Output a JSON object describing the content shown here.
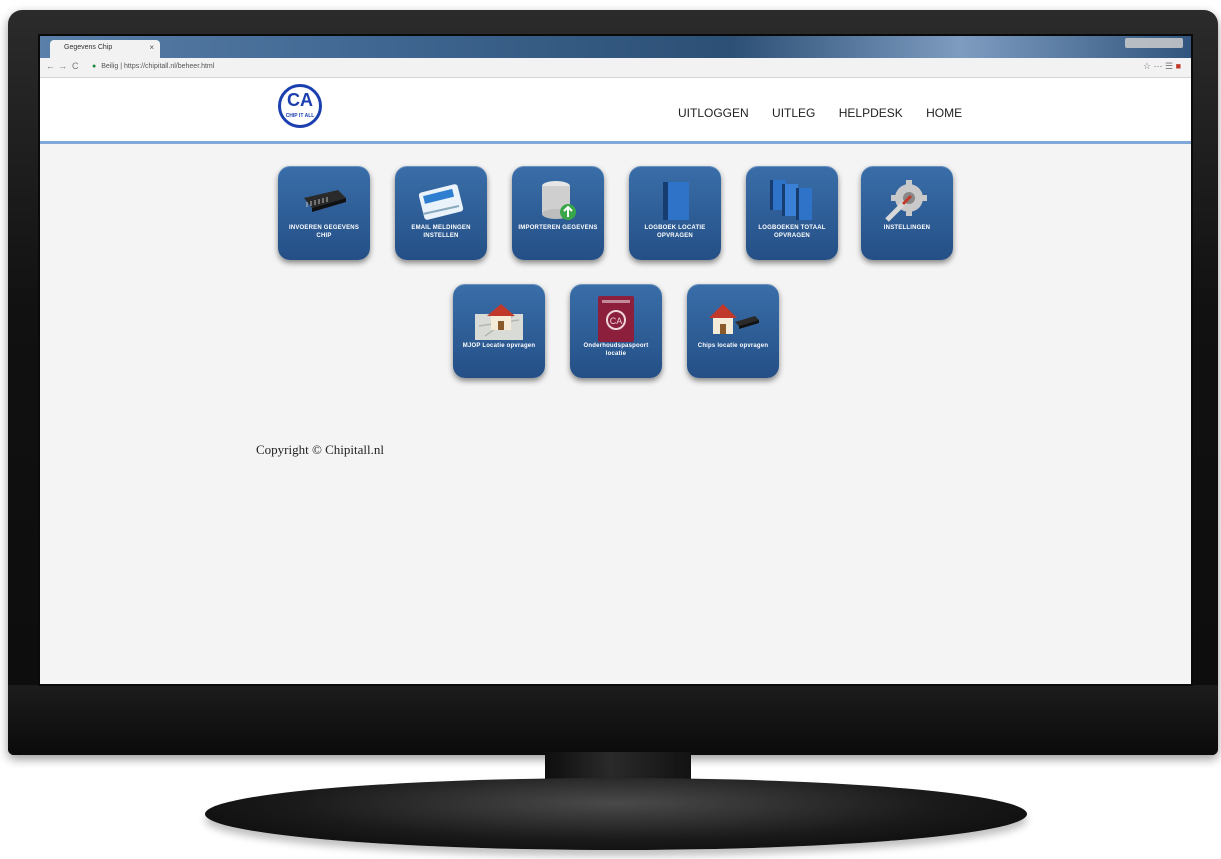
{
  "browser": {
    "tab_title": "Gegevens Chip",
    "tab_close": "×",
    "back_glyph": "←",
    "forward_glyph": "→",
    "reload_glyph": "C",
    "secure_label": "Beilig",
    "url": "https://chipitall.nl/beheer.html",
    "toolbar_glyphs": "☆ ⋯ ☰"
  },
  "header": {
    "logo_letters": "CA",
    "logo_subtext": "CHIP IT ALL",
    "nav": [
      "UITLOGGEN",
      "UITLEG",
      "HELPDESK",
      "HOME"
    ]
  },
  "tiles": [
    {
      "label": "INVOEREN GEGEVENS CHIP",
      "icon": "chip-icon"
    },
    {
      "label": "EMAIL MELDINGEN INSTELLEN",
      "icon": "email-icon"
    },
    {
      "label": "IMPORTEREN GEGEVENS",
      "icon": "database-icon"
    },
    {
      "label": "LOGBOEK LOCATIE OPVRAGEN",
      "icon": "logbook-icon"
    },
    {
      "label": "LOGBOEKEN TOTAAL OPVRAGEN",
      "icon": "logbooks-icon"
    },
    {
      "label": "INSTELLINGEN",
      "icon": "settings-icon"
    },
    {
      "label": "MJOP Locatie opvragen",
      "icon": "house-map-icon"
    },
    {
      "label": "Onderhoudspaspoort locatie",
      "icon": "passport-icon"
    },
    {
      "label": "Chips locatie opvragen",
      "icon": "house-chip-icon"
    }
  ],
  "footer": {
    "copyright": "Copyright © Chipitall.nl"
  },
  "colors": {
    "tile_top": "#3a6ea9",
    "tile_bottom": "#244f86",
    "header_border": "#7fa7d8",
    "logo_blue": "#1b3fae"
  }
}
